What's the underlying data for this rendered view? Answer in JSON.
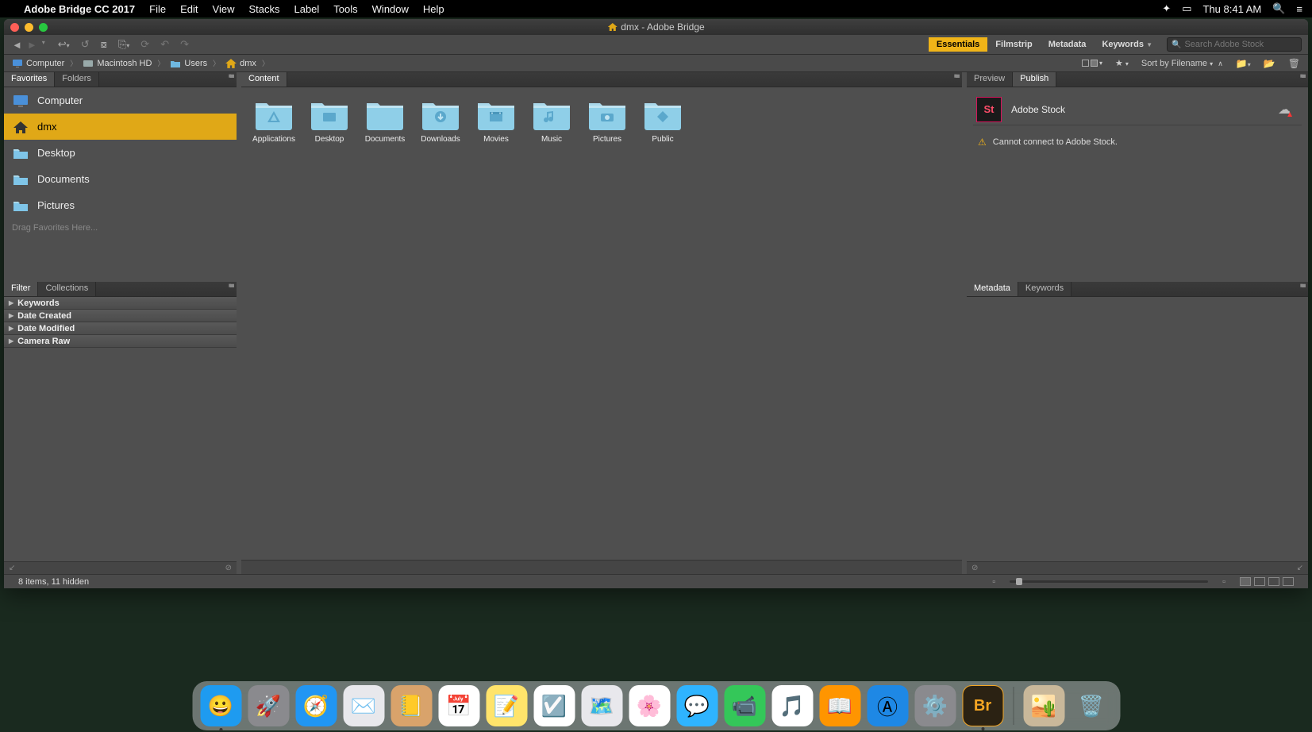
{
  "mac_menu": {
    "app": "Adobe Bridge CC 2017",
    "items": [
      "File",
      "Edit",
      "View",
      "Stacks",
      "Label",
      "Tools",
      "Window",
      "Help"
    ],
    "clock": "Thu 8:41 AM"
  },
  "window": {
    "title": "dmx - Adobe Bridge"
  },
  "workspaces": [
    "Essentials",
    "Filmstrip",
    "Metadata",
    "Keywords"
  ],
  "active_workspace": 0,
  "search_placeholder": "Search Adobe Stock",
  "path": [
    {
      "label": "Computer",
      "icon": "monitor"
    },
    {
      "label": "Macintosh HD",
      "icon": "drive"
    },
    {
      "label": "Users",
      "icon": "folder"
    },
    {
      "label": "dmx",
      "icon": "home"
    }
  ],
  "sort_label": "Sort by Filename",
  "left_top_tabs": [
    "Favorites",
    "Folders"
  ],
  "left_top_active": 0,
  "favorites": [
    {
      "label": "Computer",
      "icon": "monitor",
      "selected": false
    },
    {
      "label": "dmx",
      "icon": "home",
      "selected": true
    },
    {
      "label": "Desktop",
      "icon": "folder",
      "selected": false
    },
    {
      "label": "Documents",
      "icon": "folder",
      "selected": false
    },
    {
      "label": "Pictures",
      "icon": "folder",
      "selected": false
    }
  ],
  "drag_hint": "Drag Favorites Here...",
  "left_bottom_tabs": [
    "Filter",
    "Collections"
  ],
  "left_bottom_active": 0,
  "filters": [
    "Keywords",
    "Date Created",
    "Date Modified",
    "Camera Raw"
  ],
  "content_tab": "Content",
  "content_items": [
    {
      "label": "Applications",
      "glyph": "A"
    },
    {
      "label": "Desktop",
      "glyph": "▭"
    },
    {
      "label": "Documents",
      "glyph": ""
    },
    {
      "label": "Downloads",
      "glyph": "↓"
    },
    {
      "label": "Movies",
      "glyph": "▦"
    },
    {
      "label": "Music",
      "glyph": "♪"
    },
    {
      "label": "Pictures",
      "glyph": "📷"
    },
    {
      "label": "Public",
      "glyph": "◆"
    }
  ],
  "right_top_tabs": [
    "Preview",
    "Publish"
  ],
  "right_top_active": 1,
  "stock_title": "Adobe Stock",
  "stock_error": "Cannot connect to Adobe Stock.",
  "right_bottom_tabs": [
    "Metadata",
    "Keywords"
  ],
  "right_bottom_active": 0,
  "status": "8 items, 11 hidden",
  "dock": [
    {
      "name": "finder",
      "bg": "#1e9bf0",
      "glyph": "😀",
      "run": true
    },
    {
      "name": "launchpad",
      "bg": "#8a8a8e",
      "glyph": "🚀"
    },
    {
      "name": "safari",
      "bg": "#2196f3",
      "glyph": "🧭"
    },
    {
      "name": "mail",
      "bg": "#e8e8ec",
      "glyph": "✉️"
    },
    {
      "name": "contacts",
      "bg": "#d9a36b",
      "glyph": "📒"
    },
    {
      "name": "calendar",
      "bg": "#fff",
      "glyph": "📅"
    },
    {
      "name": "notes",
      "bg": "#ffe46b",
      "glyph": "📝"
    },
    {
      "name": "reminders",
      "bg": "#fff",
      "glyph": "☑️"
    },
    {
      "name": "maps",
      "bg": "#e8e8ec",
      "glyph": "🗺️"
    },
    {
      "name": "photos",
      "bg": "#fff",
      "glyph": "🌸"
    },
    {
      "name": "messages",
      "bg": "#2fb4ff",
      "glyph": "💬"
    },
    {
      "name": "facetime",
      "bg": "#34c759",
      "glyph": "📹"
    },
    {
      "name": "itunes",
      "bg": "#fff",
      "glyph": "🎵"
    },
    {
      "name": "ibooks",
      "bg": "#ff9500",
      "glyph": "📖"
    },
    {
      "name": "appstore",
      "bg": "#1e88e5",
      "glyph": "Ⓐ"
    },
    {
      "name": "sysprefs",
      "bg": "#8a8a8e",
      "glyph": "⚙️"
    },
    {
      "name": "bridge",
      "bg": "#2b2213",
      "glyph": "Br",
      "run": true,
      "text": true,
      "color": "#f5a623"
    }
  ],
  "dock_right": [
    {
      "name": "desktop-pic",
      "bg": "#c9b89a",
      "glyph": "🏜️"
    },
    {
      "name": "trash",
      "bg": "transparent",
      "glyph": "🗑️"
    }
  ]
}
